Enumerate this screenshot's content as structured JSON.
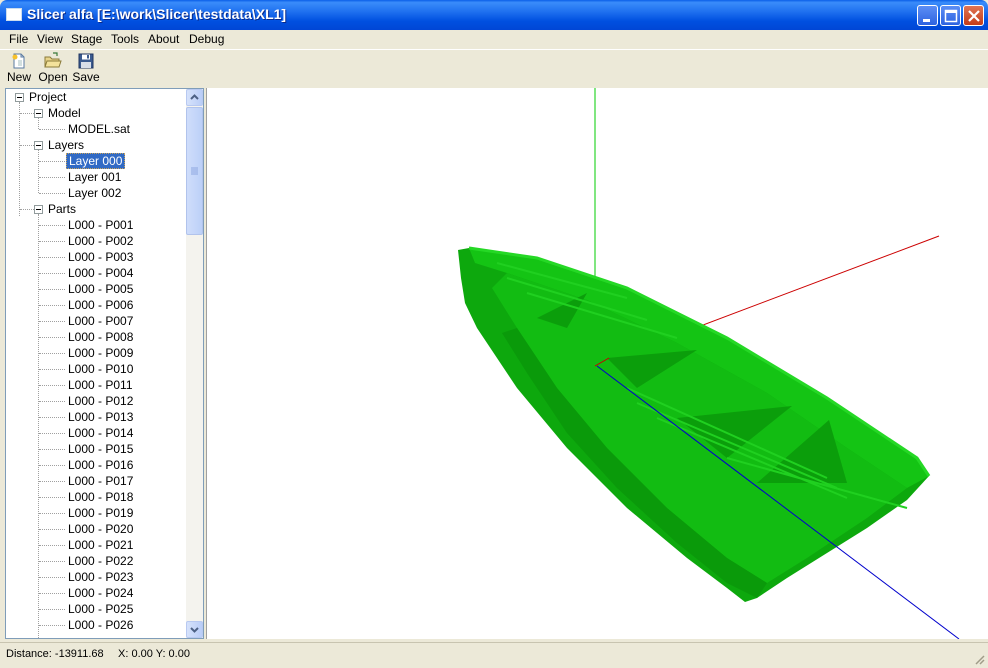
{
  "window": {
    "title": "Slicer alfa [E:\\work\\Slicer\\testdata\\XL1]",
    "buttons": [
      "minimize-icon",
      "maximize-icon",
      "close-icon"
    ]
  },
  "menu": [
    "File",
    "View",
    "Stage",
    "Tools",
    "About",
    "Debug"
  ],
  "toolbar": [
    {
      "label": "New",
      "icon": "new-document-icon"
    },
    {
      "label": "Open",
      "icon": "open-folder-icon"
    },
    {
      "label": "Save",
      "icon": "floppy-disk-icon"
    }
  ],
  "tree": {
    "root": "Project",
    "model_label": "Model",
    "model_file": "MODEL.sat",
    "layers_label": "Layers",
    "layers": [
      "Layer 000",
      "Layer 001",
      "Layer 002"
    ],
    "selected_layer": "Layer 000",
    "parts_label": "Parts",
    "parts": [
      "L000 - P001",
      "L000 - P002",
      "L000 - P003",
      "L000 - P004",
      "L000 - P005",
      "L000 - P006",
      "L000 - P007",
      "L000 - P008",
      "L000 - P009",
      "L000 - P010",
      "L000 - P011",
      "L000 - P012",
      "L000 - P013",
      "L000 - P014",
      "L000 - P015",
      "L000 - P016",
      "L000 - P017",
      "L000 - P018",
      "L000 - P019",
      "L000 - P020",
      "L000 - P021",
      "L000 - P022",
      "L000 - P023",
      "L000 - P024",
      "L000 - P025",
      "L000 - P026"
    ]
  },
  "status": {
    "distance": "Distance: -13911.68",
    "coords": "X: 0.00 Y: 0.00"
  },
  "colors": {
    "model_green": "#0DB80D",
    "axis_x": "#CC0000",
    "axis_y": "#00CC00",
    "axis_z": "#0000CC",
    "selection": "#316AC5"
  }
}
